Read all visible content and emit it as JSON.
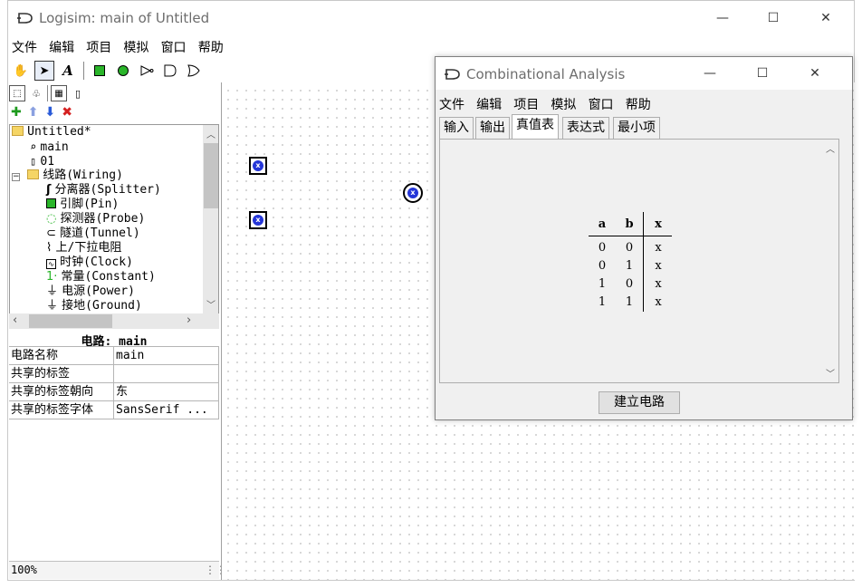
{
  "main_window": {
    "title": "Logisim: main of Untitled",
    "menu": [
      "文件",
      "编辑",
      "项目",
      "模拟",
      "窗口",
      "帮助"
    ],
    "controls": {
      "minimize": "—",
      "maximize": "☐",
      "close": "✕"
    }
  },
  "tree": {
    "items": [
      {
        "label": "Untitled*",
        "icon": "folder-icon"
      },
      {
        "label": "main",
        "icon": "circuit-icon"
      },
      {
        "label": "01",
        "icon": "circuit-icon"
      },
      {
        "label": "线路(Wiring)",
        "icon": "folder-icon"
      },
      {
        "label": "分离器(Splitter)",
        "icon": "splitter-icon"
      },
      {
        "label": "引脚(Pin)",
        "icon": "pin-icon"
      },
      {
        "label": "探测器(Probe)",
        "icon": "probe-icon"
      },
      {
        "label": "隧道(Tunnel)",
        "icon": "tunnel-icon"
      },
      {
        "label": "上/下拉电阻",
        "icon": "resistor-icon"
      },
      {
        "label": "时钟(Clock)",
        "icon": "clock-icon"
      },
      {
        "label": "常量(Constant)",
        "icon": "constant-icon"
      },
      {
        "label": "电源(Power)",
        "icon": "power-icon"
      },
      {
        "label": "接地(Ground)",
        "icon": "ground-icon"
      }
    ]
  },
  "attributes": {
    "header": "电路: main",
    "rows": [
      {
        "name": "电路名称",
        "value": "main"
      },
      {
        "name": "共享的标签",
        "value": ""
      },
      {
        "name": "共享的标签朝向",
        "value": "东"
      },
      {
        "name": "共享的标签字体",
        "value": "SansSerif ..."
      }
    ]
  },
  "zoom": "100%",
  "dialog": {
    "title": "Combinational Analysis",
    "menu": [
      "文件",
      "编辑",
      "项目",
      "模拟",
      "窗口",
      "帮助"
    ],
    "tabs": [
      "输入",
      "输出",
      "真值表",
      "表达式",
      "最小项"
    ],
    "active_tab": "真值表",
    "truth_table": {
      "headers": [
        "a",
        "b",
        "x"
      ],
      "rows": [
        [
          "0",
          "0",
          "x"
        ],
        [
          "0",
          "1",
          "x"
        ],
        [
          "1",
          "0",
          "x"
        ],
        [
          "1",
          "1",
          "x"
        ]
      ]
    },
    "build_button": "建立电路"
  },
  "colors": {
    "pin_blue": "#2536d8",
    "add_green": "#1e9a1e",
    "move_blue": "#2a5bd8",
    "delete_red": "#d42020"
  }
}
